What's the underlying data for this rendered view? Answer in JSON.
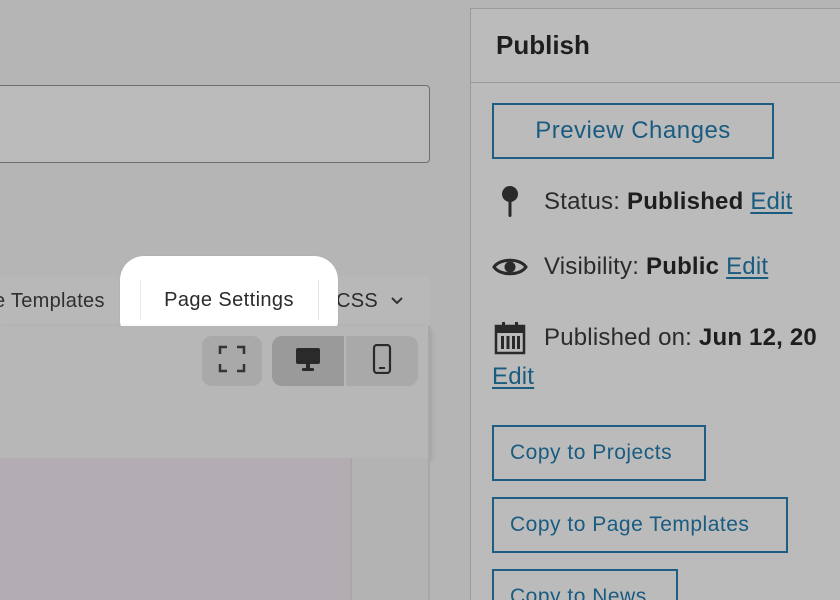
{
  "editor": {
    "tabs": {
      "templates_label": "e Templates",
      "page_settings_label": "Page Settings",
      "css_label": "CSS"
    }
  },
  "publish": {
    "heading": "Publish",
    "preview_button": "Preview Changes",
    "status_label": "Status:",
    "status_value": "Published",
    "visibility_label": "Visibility:",
    "visibility_value": "Public",
    "published_label": "Published on:",
    "published_value": "Jun 12, 20",
    "edit_label": "Edit",
    "copy_buttons": [
      "Copy to Projects",
      "Copy to Page Templates",
      "Copy to News"
    ]
  },
  "colors": {
    "accent": "#1a5b80",
    "overlay": "#b5b5b5",
    "highlight": "#ffffff"
  },
  "icons": [
    "pin-icon",
    "eye-icon",
    "calendar-icon",
    "fullscreen-icon",
    "desktop-icon",
    "mobile-icon",
    "chevron-down-icon"
  ]
}
